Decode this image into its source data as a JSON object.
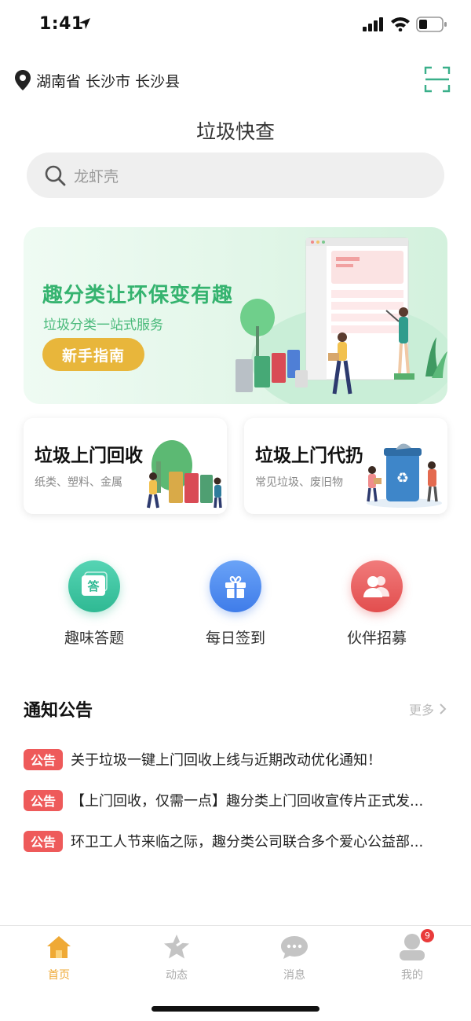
{
  "status_bar": {
    "time": "1:41"
  },
  "location": {
    "text": "湖南省 长沙市 长沙县"
  },
  "header": {
    "title": "垃圾快查"
  },
  "search": {
    "placeholder": "龙虾壳"
  },
  "banner": {
    "title": "趣分类让环保变有趣",
    "subtitle": "垃圾分类一站式服务",
    "button_label": "新手指南"
  },
  "service_cards": [
    {
      "title": "垃圾上门回收",
      "subtitle": "纸类、塑料、金属"
    },
    {
      "title": "垃圾上门代扔",
      "subtitle": "常见垃圾、废旧物"
    }
  ],
  "quick_actions": [
    {
      "label": "趣味答题",
      "icon": "quiz-icon",
      "icon_text": "答",
      "color": "#3cc29d"
    },
    {
      "label": "每日签到",
      "icon": "gift-icon",
      "color": "#4a86ef"
    },
    {
      "label": "伙伴招募",
      "icon": "people-icon",
      "color": "#e95757"
    }
  ],
  "notices": {
    "title": "通知公告",
    "more_label": "更多",
    "items": [
      {
        "badge": "公告",
        "text": "关于垃圾一键上门回收上线与近期改动优化通知！"
      },
      {
        "badge": "公告",
        "text": "【上门回收，仅需一点】趣分类上门回收宣传片正式发..."
      },
      {
        "badge": "公告",
        "text": "环卫工人节来临之际，趣分类公司联合多个爱心公益部..."
      }
    ]
  },
  "tab_bar": {
    "active": "首页",
    "items": [
      {
        "label": "首页",
        "icon": "home-icon"
      },
      {
        "label": "动态",
        "icon": "star-icon"
      },
      {
        "label": "消息",
        "icon": "chat-icon"
      },
      {
        "label": "我的",
        "icon": "user-icon",
        "badge": "9"
      }
    ]
  },
  "colors": {
    "accent": "#efa935",
    "banner_green": "#35b36f",
    "banner_button": "#e8b63b",
    "notice_badge": "#ee5a5a"
  }
}
